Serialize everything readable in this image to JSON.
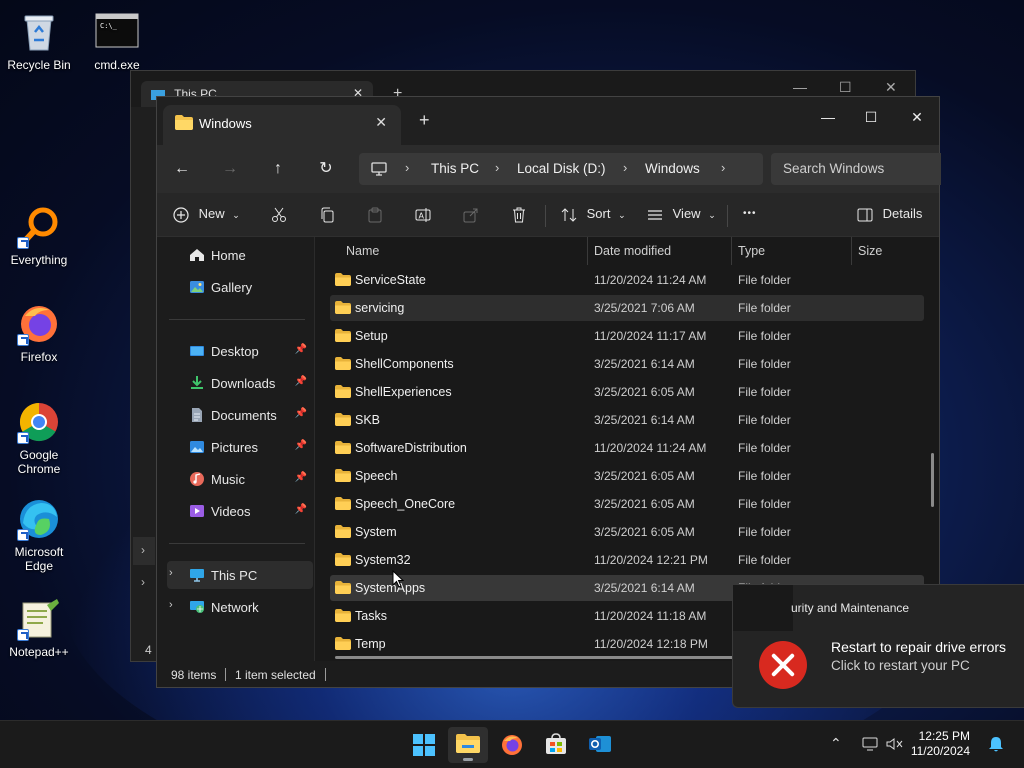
{
  "desktop": {
    "icons": [
      {
        "label": "Recycle Bin"
      },
      {
        "label": "cmd.exe"
      },
      {
        "label": "Everything"
      },
      {
        "label": "Firefox"
      },
      {
        "label": "Google Chrome"
      },
      {
        "label": "Microsoft Edge"
      },
      {
        "label": "Notepad++"
      }
    ]
  },
  "background_window": {
    "tab_title": "This PC",
    "status_count": "4"
  },
  "window": {
    "tab_title": "Windows",
    "breadcrumbs": [
      "This PC",
      "Local Disk (D:)",
      "Windows"
    ],
    "search_placeholder": "Search Windows",
    "toolbar": {
      "new_label": "New",
      "sort_label": "Sort",
      "view_label": "View",
      "more_label": "•••",
      "details_label": "Details"
    },
    "sidebar": {
      "items": [
        {
          "label": "Home",
          "icon": "home-icon"
        },
        {
          "label": "Gallery",
          "icon": "gallery-icon"
        },
        {
          "label": "Desktop",
          "icon": "desktop-icon"
        },
        {
          "label": "Downloads",
          "icon": "downloads-icon"
        },
        {
          "label": "Documents",
          "icon": "documents-icon"
        },
        {
          "label": "Pictures",
          "icon": "pictures-icon"
        },
        {
          "label": "Music",
          "icon": "music-icon"
        },
        {
          "label": "Videos",
          "icon": "videos-icon"
        },
        {
          "label": "This PC",
          "icon": "computer-icon"
        },
        {
          "label": "Network",
          "icon": "network-icon"
        }
      ]
    },
    "columns": {
      "name": "Name",
      "date": "Date modified",
      "type": "Type",
      "size": "Size"
    },
    "rows": [
      {
        "name": "ServiceState",
        "date": "11/20/2024 11:24 AM",
        "type": "File folder"
      },
      {
        "name": "servicing",
        "date": "3/25/2021 7:06 AM",
        "type": "File folder"
      },
      {
        "name": "Setup",
        "date": "11/20/2024 11:17 AM",
        "type": "File folder"
      },
      {
        "name": "ShellComponents",
        "date": "3/25/2021 6:14 AM",
        "type": "File folder"
      },
      {
        "name": "ShellExperiences",
        "date": "3/25/2021 6:05 AM",
        "type": "File folder"
      },
      {
        "name": "SKB",
        "date": "3/25/2021 6:14 AM",
        "type": "File folder"
      },
      {
        "name": "SoftwareDistribution",
        "date": "11/20/2024 11:24 AM",
        "type": "File folder"
      },
      {
        "name": "Speech",
        "date": "3/25/2021 6:05 AM",
        "type": "File folder"
      },
      {
        "name": "Speech_OneCore",
        "date": "3/25/2021 6:05 AM",
        "type": "File folder"
      },
      {
        "name": "System",
        "date": "3/25/2021 6:05 AM",
        "type": "File folder"
      },
      {
        "name": "System32",
        "date": "11/20/2024 12:21 PM",
        "type": "File folder"
      },
      {
        "name": "SystemApps",
        "date": "3/25/2021 6:14 AM",
        "type": "File folder"
      },
      {
        "name": "Tasks",
        "date": "11/20/2024 11:18 AM",
        "type": "File folder"
      },
      {
        "name": "Temp",
        "date": "11/20/2024 12:18 PM",
        "type": "File folder"
      }
    ],
    "status": {
      "items": "98 items",
      "selected": "1 item selected"
    }
  },
  "toast": {
    "app": "urity and Maintenance",
    "headline": "Restart to repair drive errors",
    "body": "Click to restart your PC"
  },
  "taskbar": {
    "time": "12:25 PM",
    "date": "11/20/2024"
  },
  "colors": {
    "accent": "#4cc2ff",
    "folder": "#f3c24b",
    "toast_icon": "#d8291f"
  }
}
